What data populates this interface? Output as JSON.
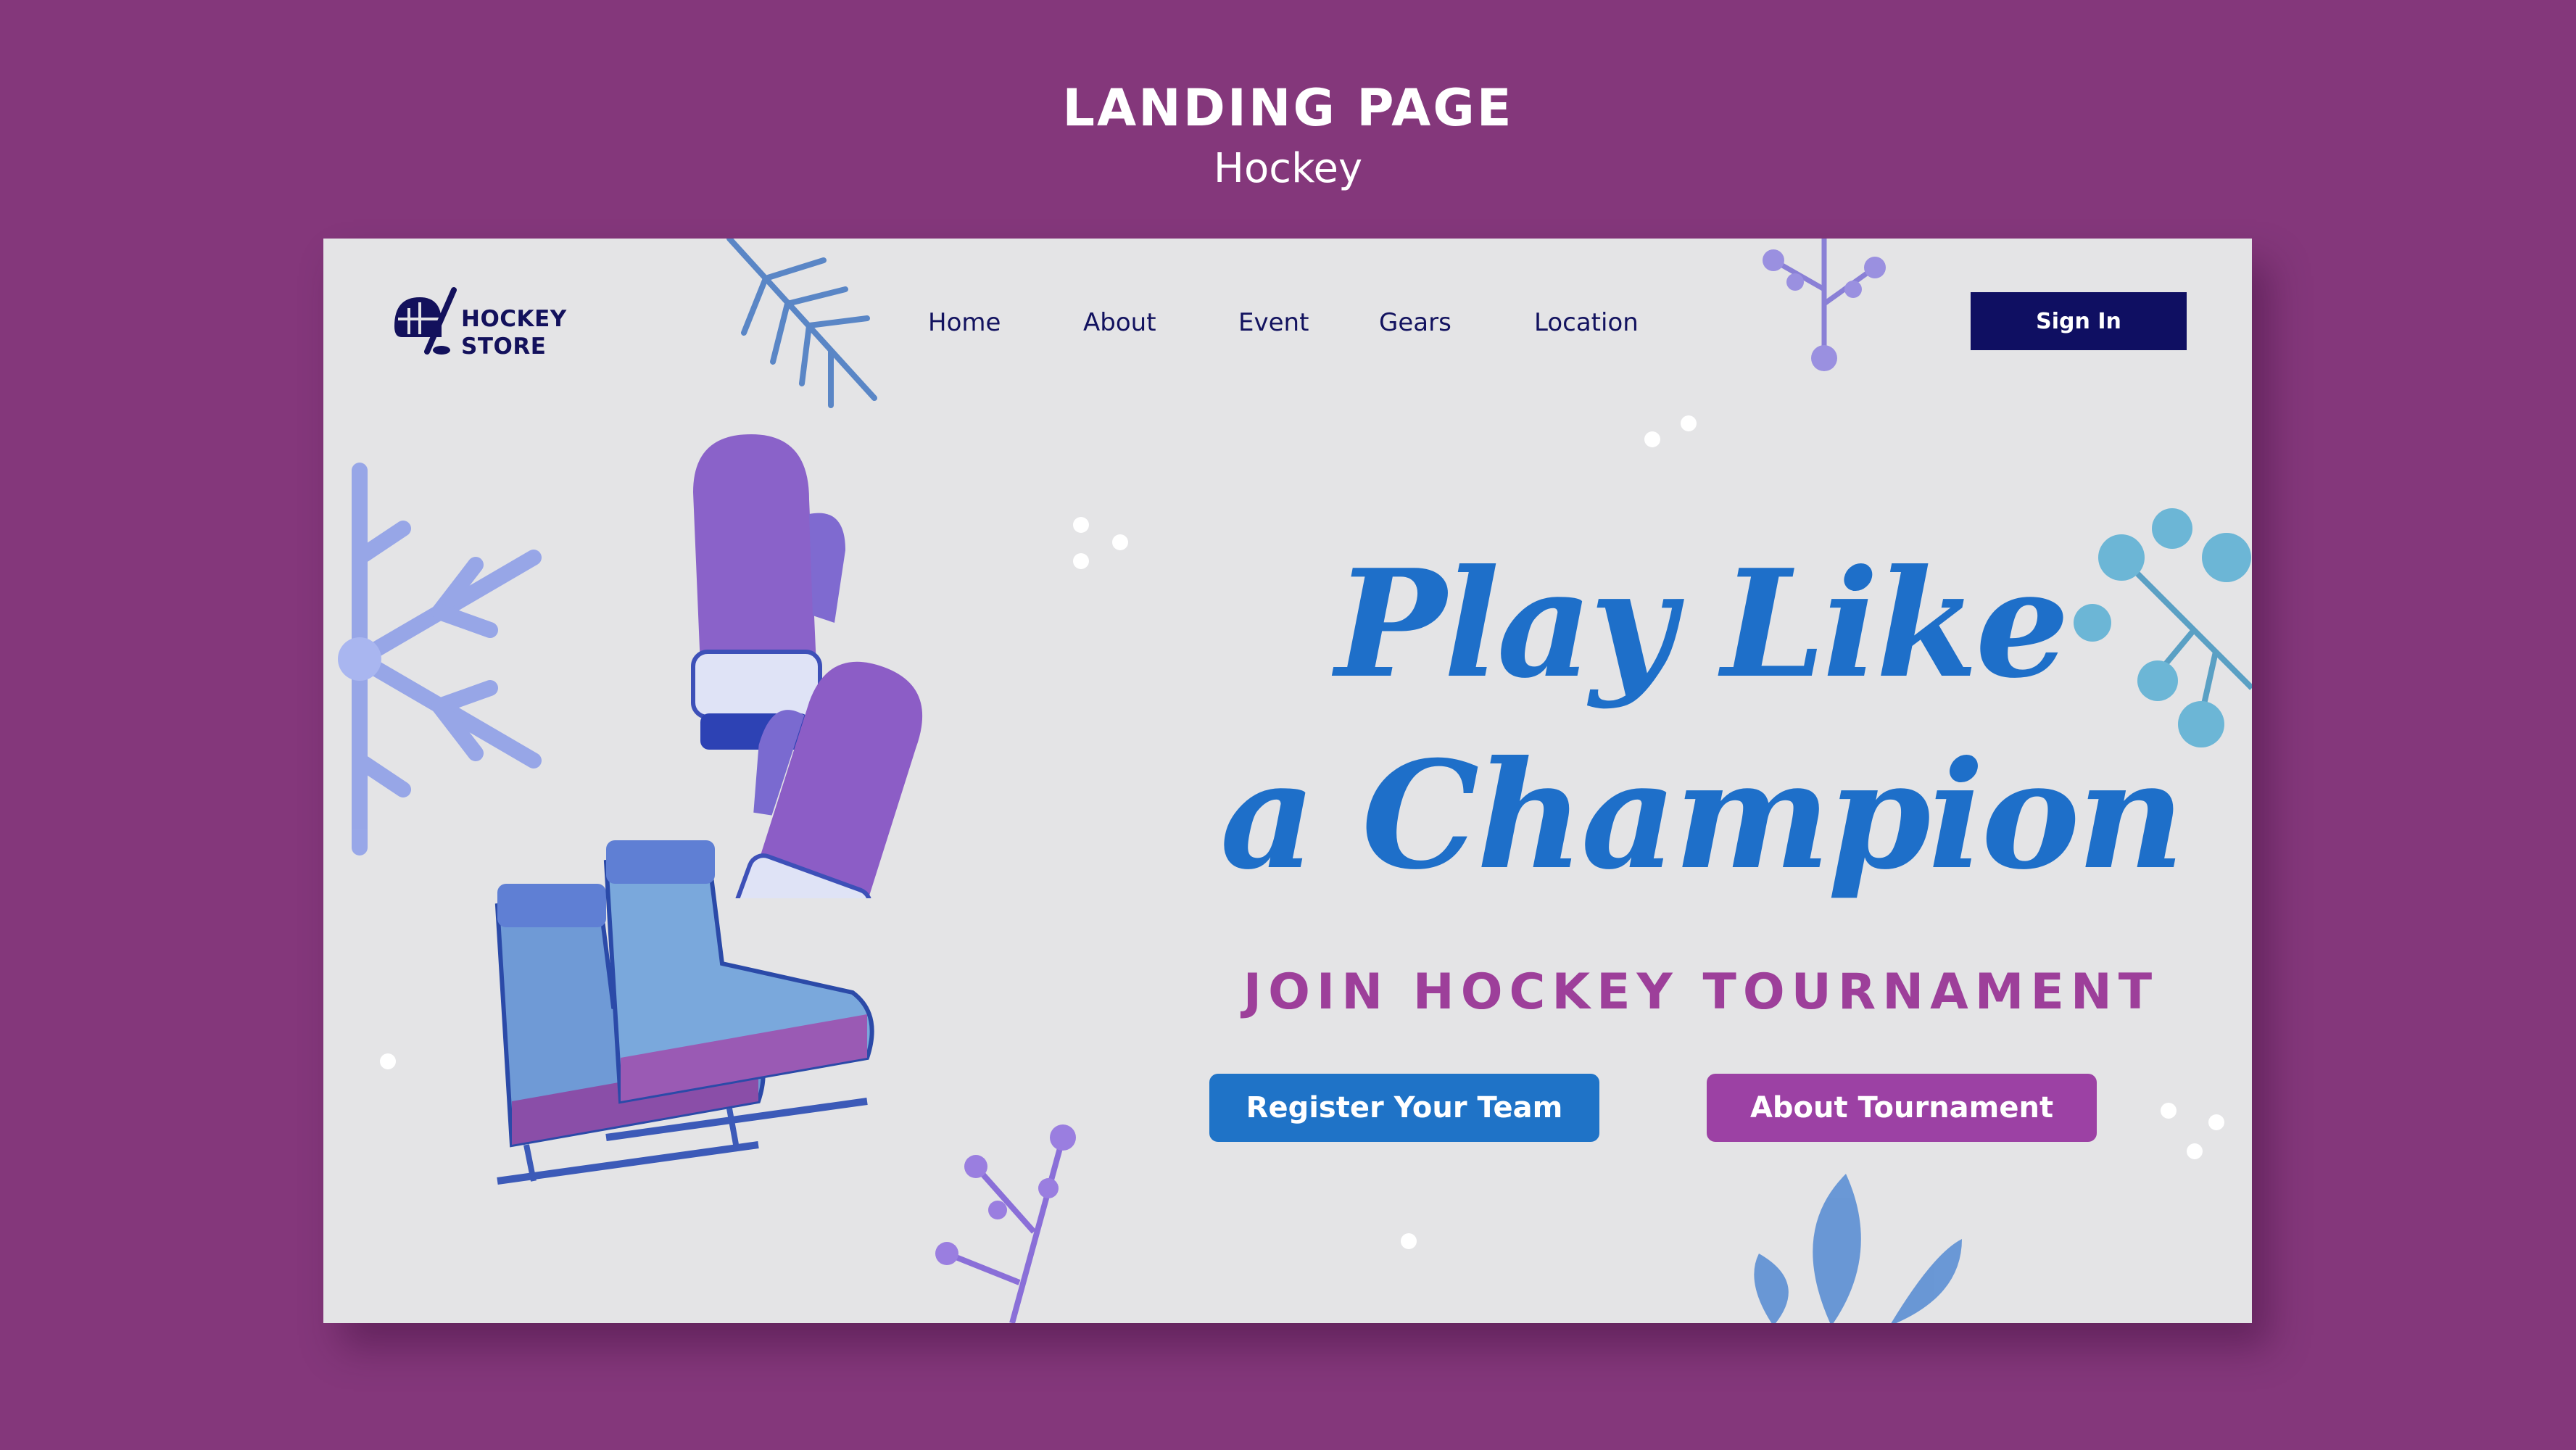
{
  "presentation": {
    "title": "LANDING PAGE",
    "subtitle": "Hockey"
  },
  "brand": {
    "line1": "HOCKEY",
    "line2": "STORE",
    "icon": "hockey-helmet-stick-icon"
  },
  "nav": {
    "items": [
      {
        "label": "Home"
      },
      {
        "label": "About"
      },
      {
        "label": "Event"
      },
      {
        "label": "Gears"
      },
      {
        "label": "Location"
      }
    ],
    "signin_label": "Sign In"
  },
  "hero": {
    "headline_line1": "Play Like",
    "headline_line2": "a Champion",
    "subheadline": "JOIN HOCKEY TOURNAMENT",
    "primary_button": "Register Your Team",
    "secondary_button": "About Tournament"
  },
  "illustrations": [
    "snowflake-icon",
    "mittens-icon",
    "ice-skates-icon",
    "pine-branch-icon",
    "berry-branch-icon",
    "leaf-icon"
  ],
  "colors": {
    "page_background": "#84377b",
    "canvas": "#e4e4e6",
    "navy": "#0f0f62",
    "headline_blue": "#1e6fc9",
    "accent_purple": "#9c41a4"
  }
}
